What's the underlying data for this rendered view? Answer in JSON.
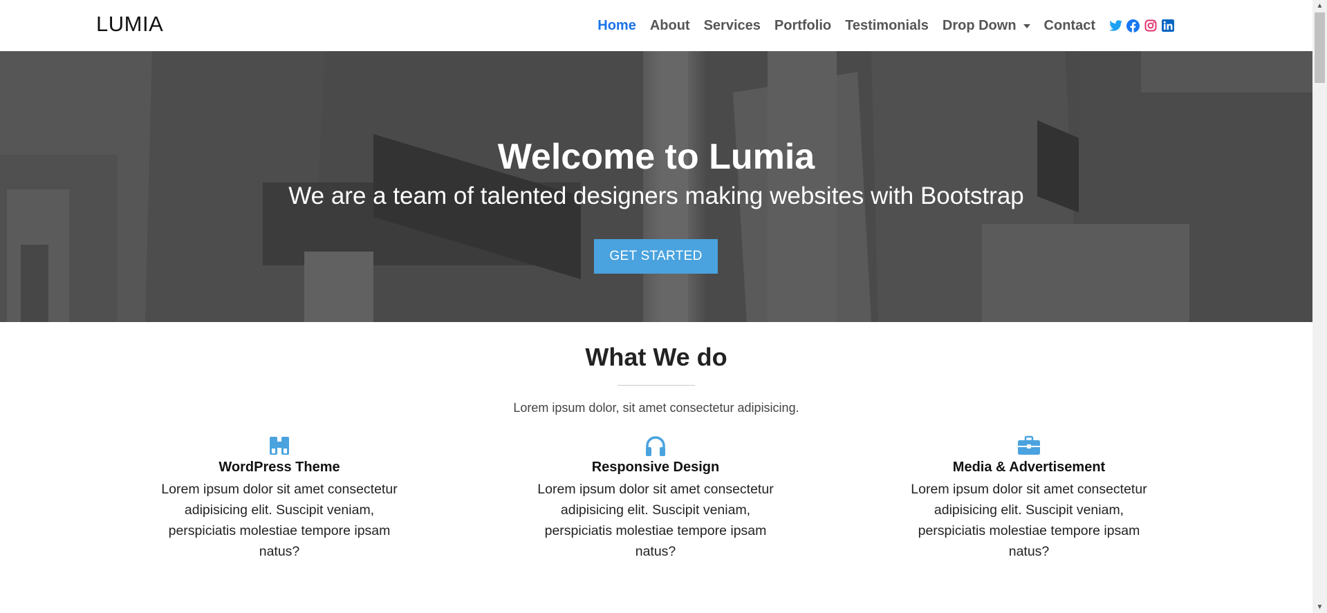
{
  "brand": "LUMIA",
  "nav": {
    "items": [
      {
        "label": "Home",
        "active": true
      },
      {
        "label": "About"
      },
      {
        "label": "Services"
      },
      {
        "label": "Portfolio"
      },
      {
        "label": "Testimonials"
      },
      {
        "label": "Drop Down",
        "dropdown": true
      },
      {
        "label": "Contact"
      }
    ],
    "socials": [
      "twitter-icon",
      "facebook-icon",
      "instagram-icon",
      "linkedin-icon"
    ]
  },
  "hero": {
    "title": "Welcome to Lumia",
    "subtitle": "We are a team of talented designers making websites with Bootstrap",
    "button": "GET STARTED"
  },
  "section": {
    "title": "What We do",
    "description": "Lorem ipsum dolor, sit amet consectetur adipisicing."
  },
  "features": [
    {
      "icon": "binoculars-icon",
      "title": "WordPress Theme",
      "text": "Lorem ipsum dolor sit amet consectetur adipisicing elit. Suscipit veniam, perspiciatis molestiae tempore ipsam natus?"
    },
    {
      "icon": "headphones-icon",
      "title": "Responsive Design",
      "text": "Lorem ipsum dolor sit amet consectetur adipisicing elit. Suscipit veniam, perspiciatis molestiae tempore ipsam natus?"
    },
    {
      "icon": "briefcase-icon",
      "title": "Media & Advertisement",
      "text": "Lorem ipsum dolor sit amet consectetur adipisicing elit. Suscipit veniam, perspiciatis molestiae tempore ipsam natus?"
    }
  ],
  "colors": {
    "accent": "#4aa3df",
    "nav_active": "#1a73e8",
    "twitter": "#1da1f2",
    "facebook": "#1877f2",
    "instagram": "#e1306c",
    "linkedin": "#0a66c2"
  }
}
